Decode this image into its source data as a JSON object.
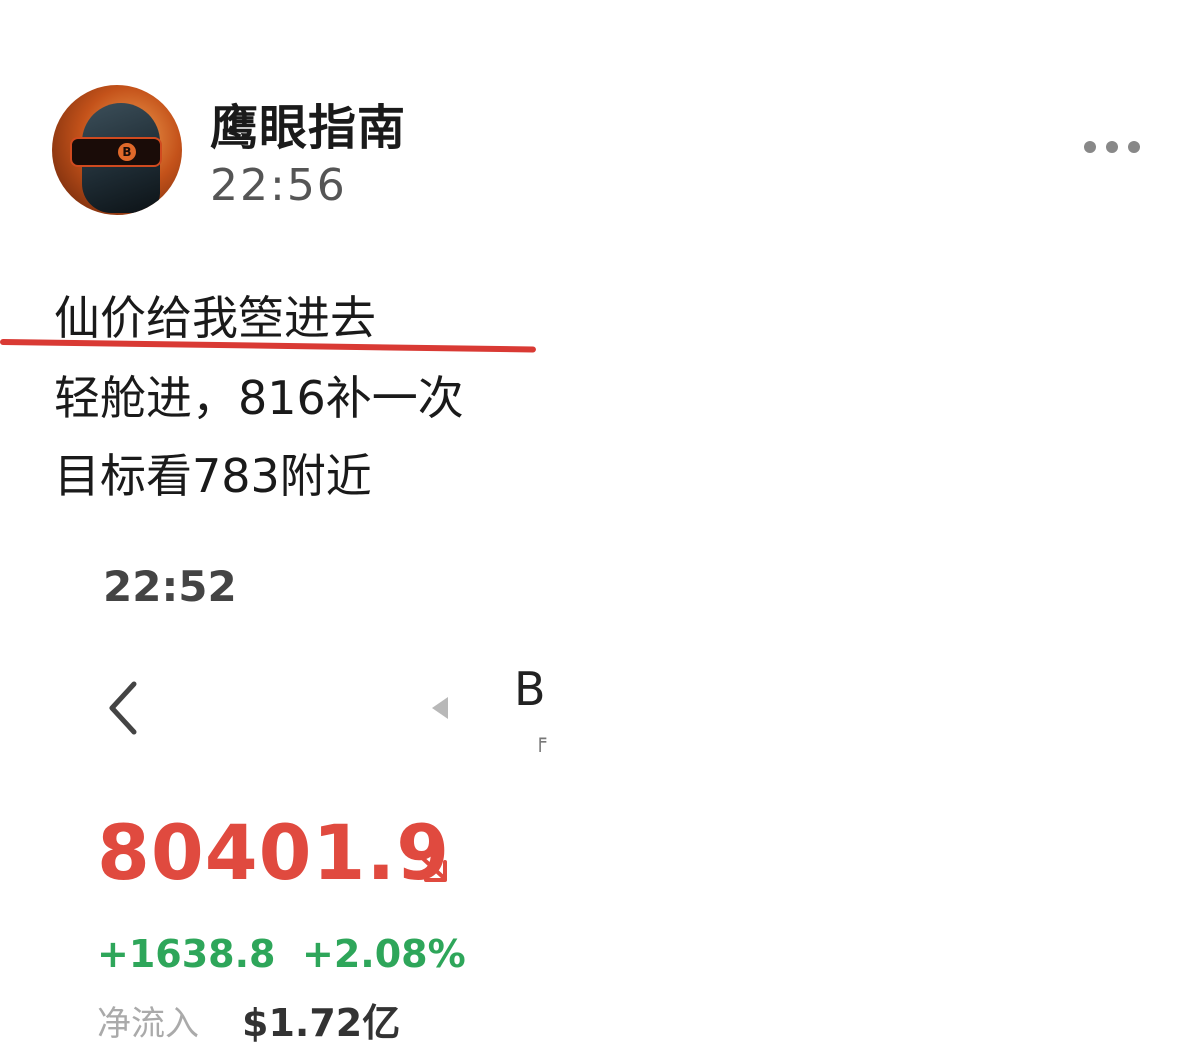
{
  "post": {
    "author": "鹰眼指南",
    "time": "22:56",
    "avatar_icon": "bitcoin-robot-avatar",
    "avatar_mark": "B",
    "more_icon": "more-dots-icon",
    "lines": [
      "仙价给我箜进去",
      "轻舱进，816补一次",
      "目标看783附近"
    ],
    "highlight_color": "#d93a34"
  },
  "screenshot": {
    "time": "22:52",
    "back_icon": "chevron-left-icon",
    "prev_icon": "triangle-left-icon",
    "symbol_initial": "B",
    "symbol_sub": "╒",
    "price": "80401.9",
    "price_color": "#e04a3f",
    "trend_icon": "arrow-down-right-icon",
    "change": "+1638.8",
    "change_percent": "+2.08%",
    "change_color": "#2ea65a",
    "net_inflow_label": "净流入",
    "net_inflow_value": "$1.72亿"
  }
}
